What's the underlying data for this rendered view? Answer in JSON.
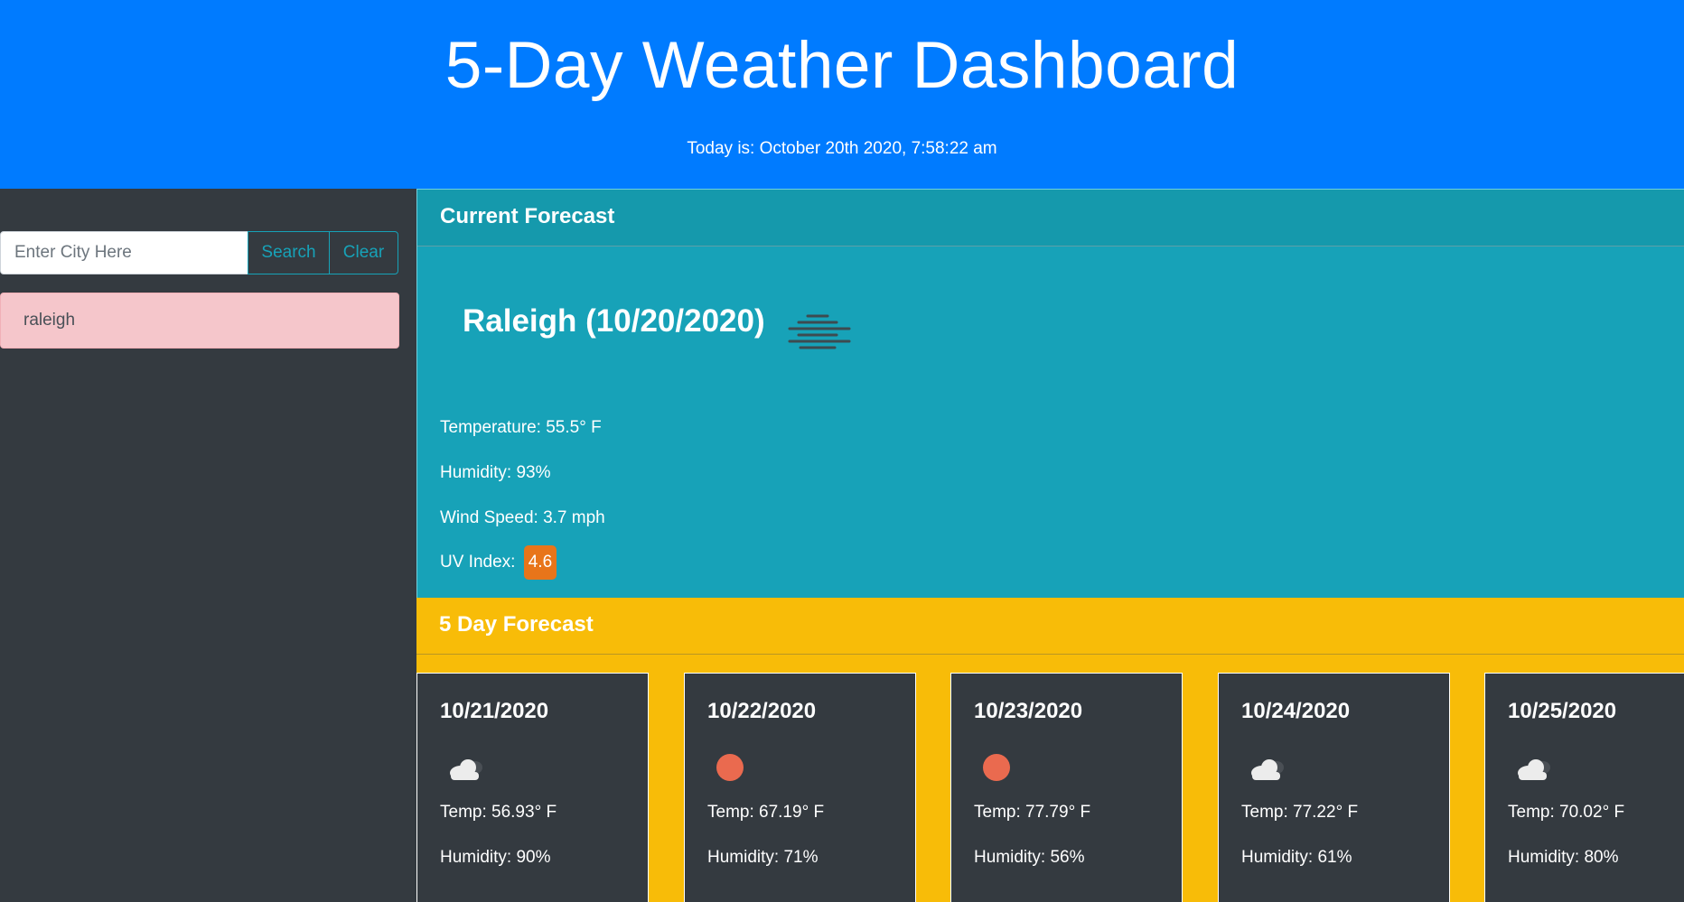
{
  "header": {
    "title": "5-Day Weather Dashboard",
    "date_text": "Today is: October 20th 2020, 7:58:22 am"
  },
  "sidebar": {
    "search_placeholder": "Enter City Here",
    "search_value": "",
    "search_label": "Search",
    "clear_label": "Clear",
    "history": [
      "raleigh"
    ]
  },
  "current": {
    "section_title": "Current Forecast",
    "city_title": "Raleigh (10/20/2020)",
    "icon": "mist-icon",
    "temperature": "Temperature: 55.5° F",
    "humidity": "Humidity: 93%",
    "wind": "Wind Speed: 3.7 mph",
    "uv_label": "UV Index:",
    "uv_value": "4.6",
    "uv_color": "#e8751a"
  },
  "forecast": {
    "section_title": "5 Day Forecast",
    "days": [
      {
        "date": "10/21/2020",
        "icon": "cloud-icon",
        "temp": "Temp: 56.93° F",
        "humidity": "Humidity: 90%"
      },
      {
        "date": "10/22/2020",
        "icon": "sun-icon",
        "temp": "Temp: 67.19° F",
        "humidity": "Humidity: 71%"
      },
      {
        "date": "10/23/2020",
        "icon": "sun-icon",
        "temp": "Temp: 77.79° F",
        "humidity": "Humidity: 56%"
      },
      {
        "date": "10/24/2020",
        "icon": "cloud-icon",
        "temp": "Temp: 77.22° F",
        "humidity": "Humidity: 61%"
      },
      {
        "date": "10/25/2020",
        "icon": "cloud-icon",
        "temp": "Temp: 70.02° F",
        "humidity": "Humidity: 80%"
      }
    ]
  },
  "colors": {
    "header_bg": "#007bff",
    "sidebar_bg": "#343a40",
    "current_bg": "#17a2b8",
    "fiveday_bg": "#f8bc08",
    "history_bg": "#f5c6cb"
  }
}
